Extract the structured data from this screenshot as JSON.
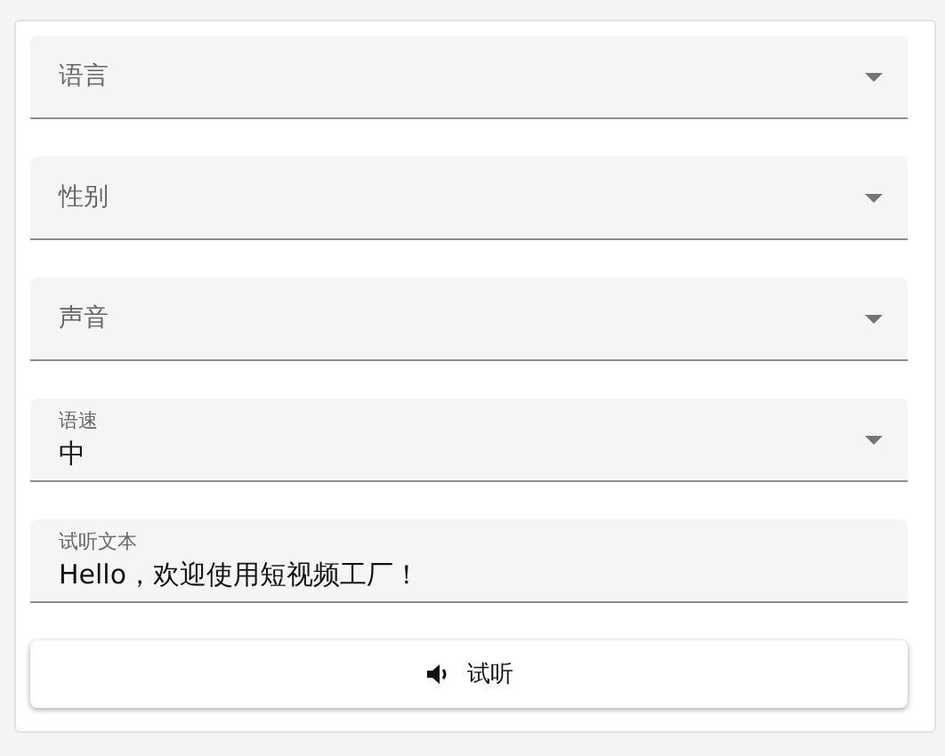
{
  "fields": [
    {
      "kind": "select",
      "label": "语言"
    },
    {
      "kind": "select",
      "label": "性别"
    },
    {
      "kind": "select",
      "label": "声音"
    },
    {
      "kind": "select",
      "label": "语速",
      "value": "中"
    },
    {
      "kind": "text",
      "label": "试听文本",
      "value": "Hello，欢迎使用短视频工厂！"
    }
  ],
  "button": {
    "label": "试听"
  }
}
